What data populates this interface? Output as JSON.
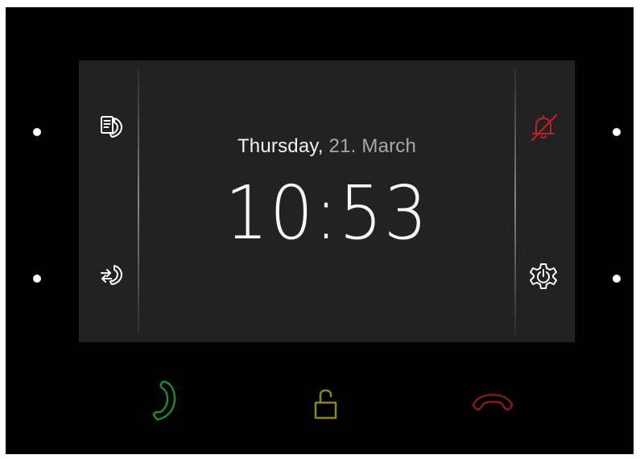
{
  "clock": {
    "weekday": "Thursday,",
    "date": "21. March",
    "time": "10:53"
  },
  "icons": {
    "left_top": "message-handset-icon",
    "left_bottom": "call-transfer-icon",
    "right_top": "muted-bell-icon",
    "right_bottom": "settings-gear-icon",
    "bottom_left": "answer-call-icon",
    "bottom_center": "unlock-icon",
    "bottom_right": "hangup-icon"
  },
  "colors": {
    "screen_background": "#222222",
    "muted_bell": "#c0202a",
    "answer_call": "#1f8a2c",
    "unlock": "#8a8a10",
    "hangup": "#8a1a1a"
  }
}
